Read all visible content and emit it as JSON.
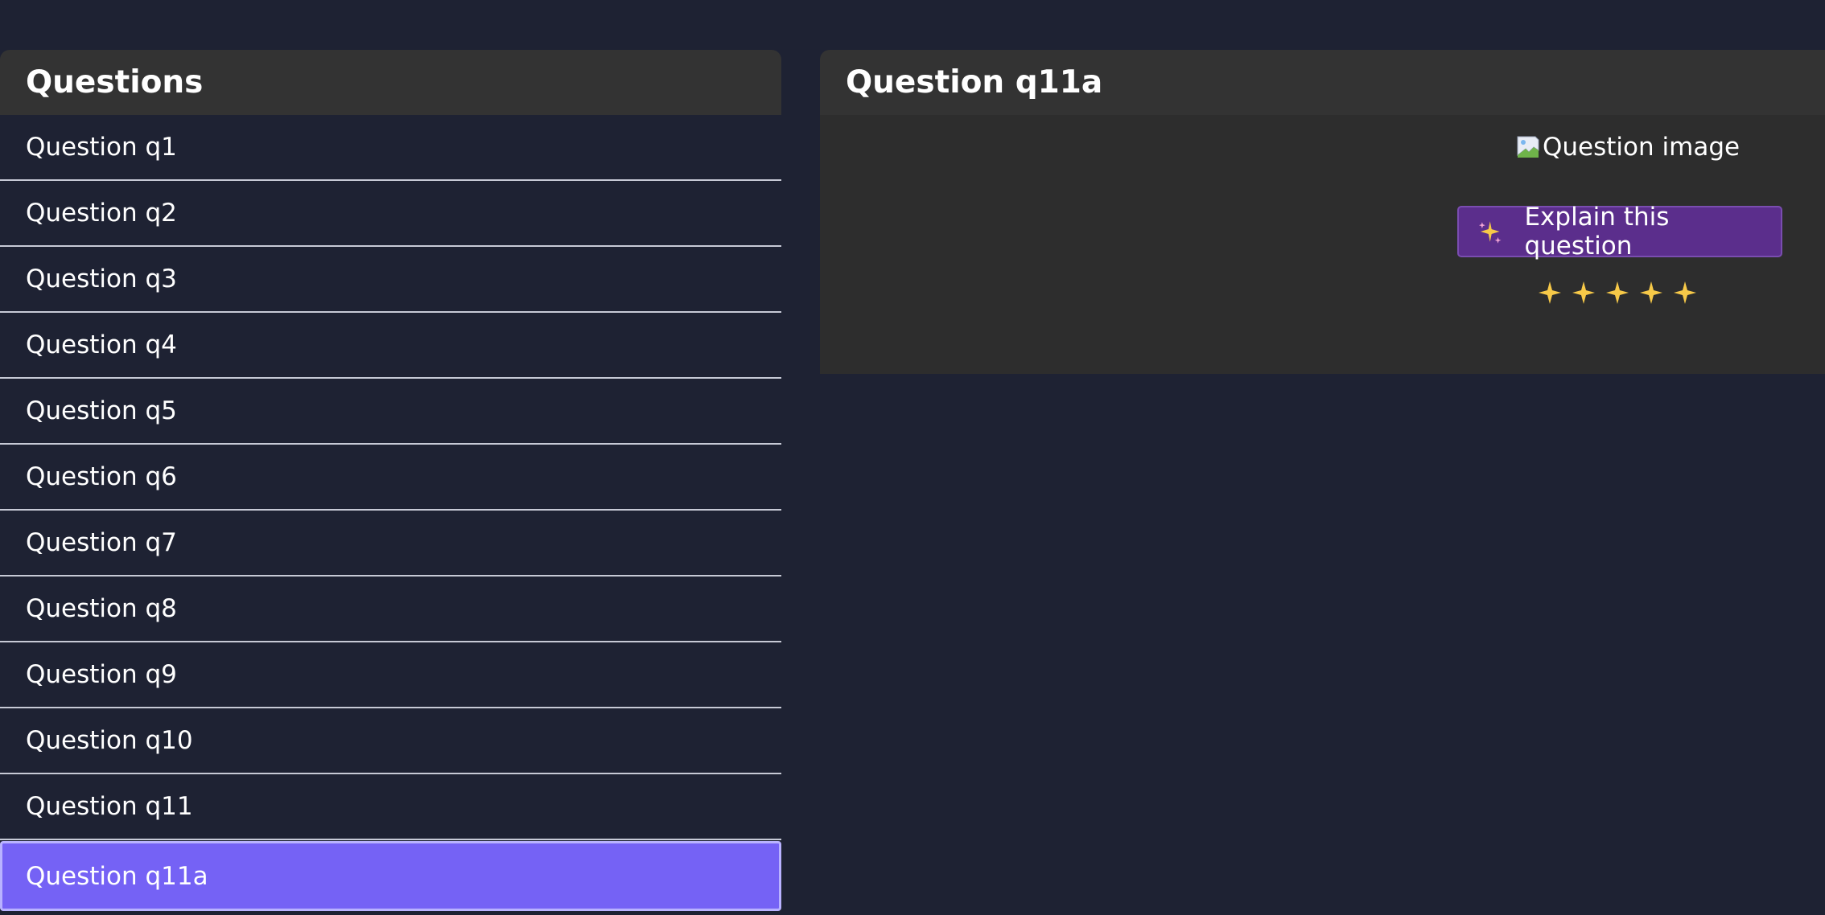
{
  "questions_panel": {
    "title": "Questions",
    "items": [
      {
        "label": "Question q1"
      },
      {
        "label": "Question q2"
      },
      {
        "label": "Question q3"
      },
      {
        "label": "Question q4"
      },
      {
        "label": "Question q5"
      },
      {
        "label": "Question q6"
      },
      {
        "label": "Question q7"
      },
      {
        "label": "Question q8"
      },
      {
        "label": "Question q9"
      },
      {
        "label": "Question q10"
      },
      {
        "label": "Question q11"
      },
      {
        "label": "Question q11a"
      }
    ],
    "selected_index": 11
  },
  "detail_panel": {
    "title": "Question q11a",
    "image_alt": "Question image",
    "explain_button_label": "Explain this question",
    "sparkle_count": 5
  },
  "colors": {
    "background": "#1e2233",
    "header_bg": "#333333",
    "detail_bg": "#2d2d2d",
    "selected_bg": "#7562f5",
    "button_bg": "#5b2e8c",
    "sparkle": "#f7c948"
  },
  "icons": {
    "broken_image": "broken-image-icon",
    "button_icon": "sparkles-icon",
    "rating": "sparkle-icon"
  }
}
